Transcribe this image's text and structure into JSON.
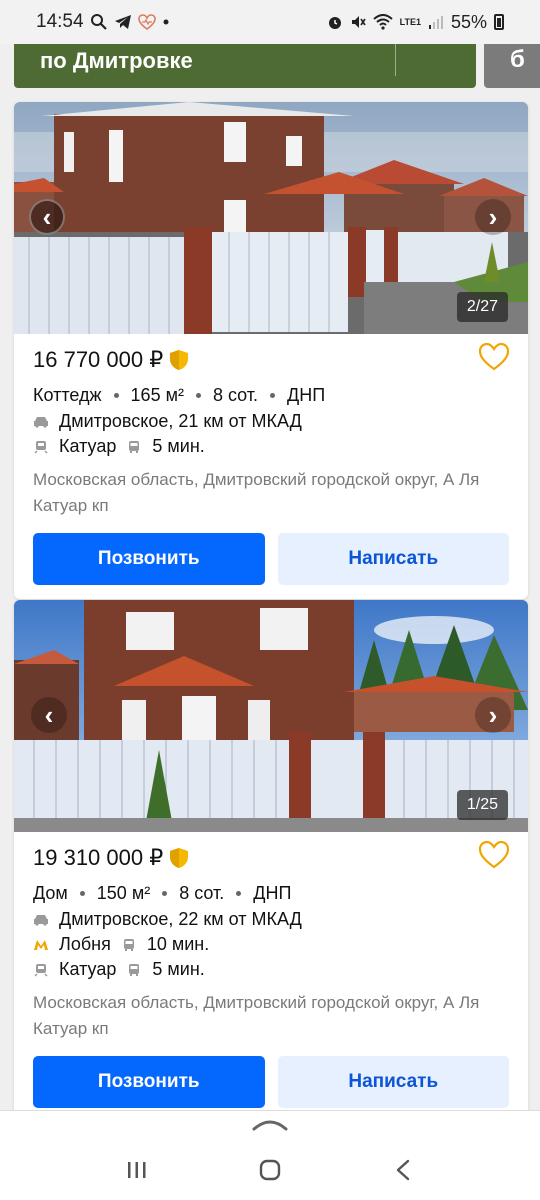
{
  "status_bar": {
    "time": "14:54",
    "network": "LTE1",
    "battery": "55%",
    "icons": [
      "search-icon",
      "telegram-icon",
      "heart-icon",
      "dot-icon",
      "alarm-icon",
      "mute-icon",
      "wifi-icon",
      "signal-icon",
      "battery-icon"
    ]
  },
  "banner": {
    "text": "по Дмитровке",
    "side_text": "б"
  },
  "listings": [
    {
      "counter": "2/27",
      "price": "16 770 000 ₽",
      "params": [
        "Коттедж",
        "165 м²",
        "8 сот.",
        "ДНП"
      ],
      "highway": "Дмитровское, 21 км от МКАД",
      "stations": [
        {
          "icon": "train-icon",
          "name": "Катуар",
          "time": "5 мин."
        }
      ],
      "address": "Московская область, Дмитровский городской округ, А Ля Катуар кп",
      "call_label": "Позвонить",
      "write_label": "Написать"
    },
    {
      "counter": "1/25",
      "price": "19 310 000 ₽",
      "params": [
        "Дом",
        "150 м²",
        "8 сот.",
        "ДНП"
      ],
      "highway": "Дмитровское, 22 км от МКАД",
      "stations": [
        {
          "icon": "metro-icon",
          "name": "Лобня",
          "time": "10 мин."
        },
        {
          "icon": "train-icon",
          "name": "Катуар",
          "time": "5 мин."
        }
      ],
      "address": "Московская область, Дмитровский городской округ, А Ля Катуар кп",
      "call_label": "Позвонить",
      "write_label": "Написать"
    }
  ],
  "colors": {
    "accent": "#0468ff",
    "favorite": "#f0a500",
    "metro": "#f0a500",
    "banner_green": "#4f6b34"
  },
  "nav": [
    "recent-apps-icon",
    "home-icon",
    "back-icon"
  ]
}
